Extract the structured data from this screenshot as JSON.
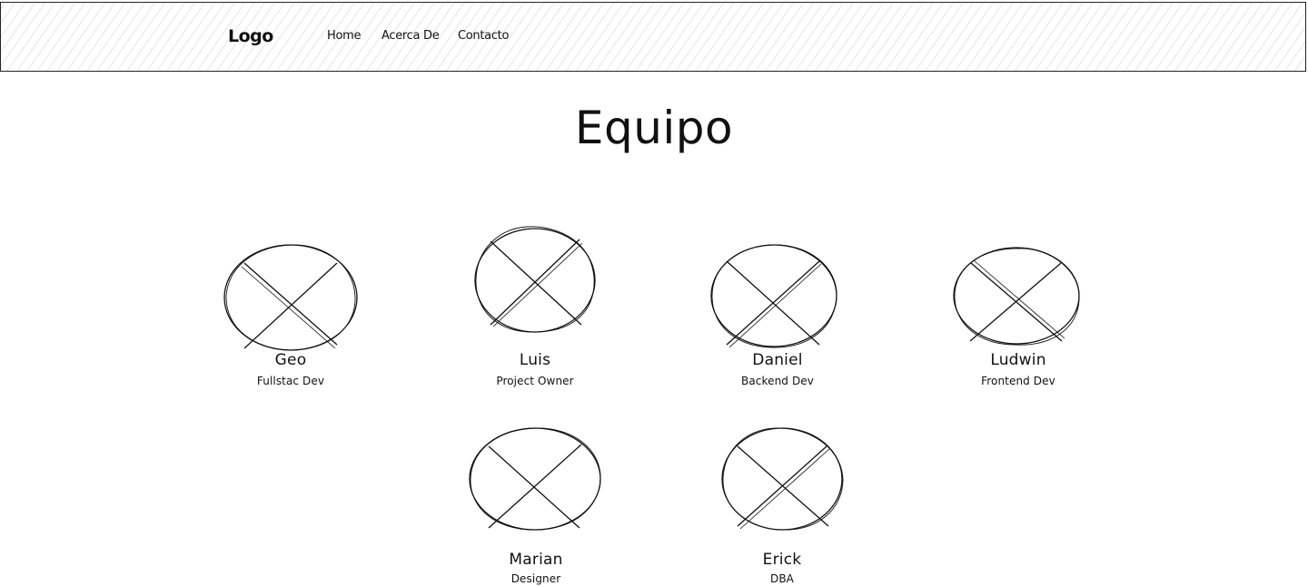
{
  "navbar": {
    "logo": "Logo",
    "links": [
      {
        "label": "Home"
      },
      {
        "label": "Acerca De"
      },
      {
        "label": "Contacto"
      }
    ]
  },
  "main": {
    "title": "Equipo",
    "members": [
      {
        "name": "Geo",
        "role": "Fullstac Dev"
      },
      {
        "name": "Luis",
        "role": "Project Owner"
      },
      {
        "name": "Daniel",
        "role": "Backend Dev"
      },
      {
        "name": "Ludwin",
        "role": "Frontend Dev"
      },
      {
        "name": "Marian",
        "role": "Designer"
      },
      {
        "name": "Erick",
        "role": "DBA"
      }
    ]
  }
}
